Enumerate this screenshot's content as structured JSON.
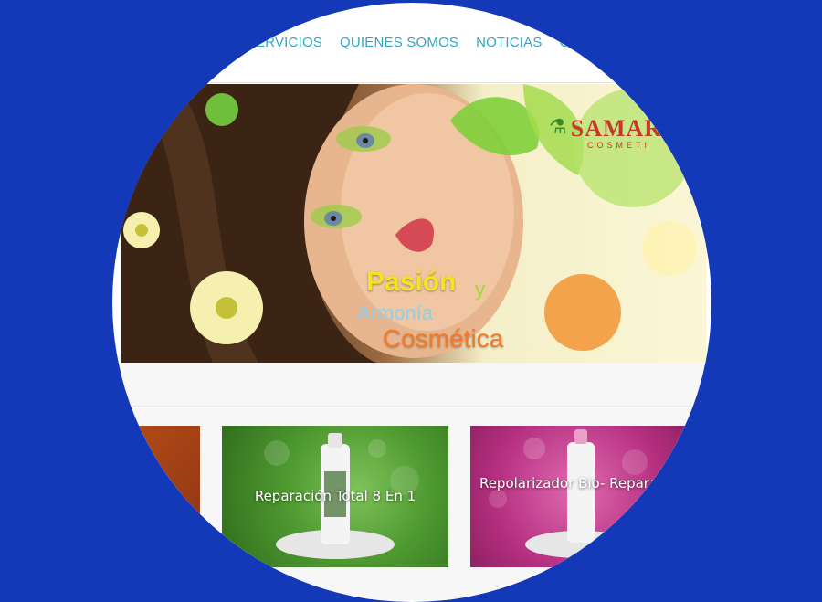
{
  "nav": {
    "items": [
      "ERVICIOS",
      "QUIENES SOMOS",
      "NOTICIAS",
      "C"
    ]
  },
  "hero": {
    "line1": "Pasión",
    "connector": "y",
    "line2": "Armonía",
    "line3": "Cosmética",
    "logo_name": "SAMAR",
    "logo_sub": "COSMETI"
  },
  "cards": [
    {
      "title": "",
      "color": "#a9431a"
    },
    {
      "title": "Reparación Total 8 En 1",
      "color": "#4f9a31"
    },
    {
      "title": "Repolarizador Bio- Reparador",
      "color": "#b52f7f"
    }
  ],
  "colors": {
    "background": "#1439b8",
    "nav_text": "#31a6c6",
    "accent_yellow": "#f3e323",
    "accent_orange": "#f07a2a",
    "accent_blue": "#8dd0ee"
  }
}
